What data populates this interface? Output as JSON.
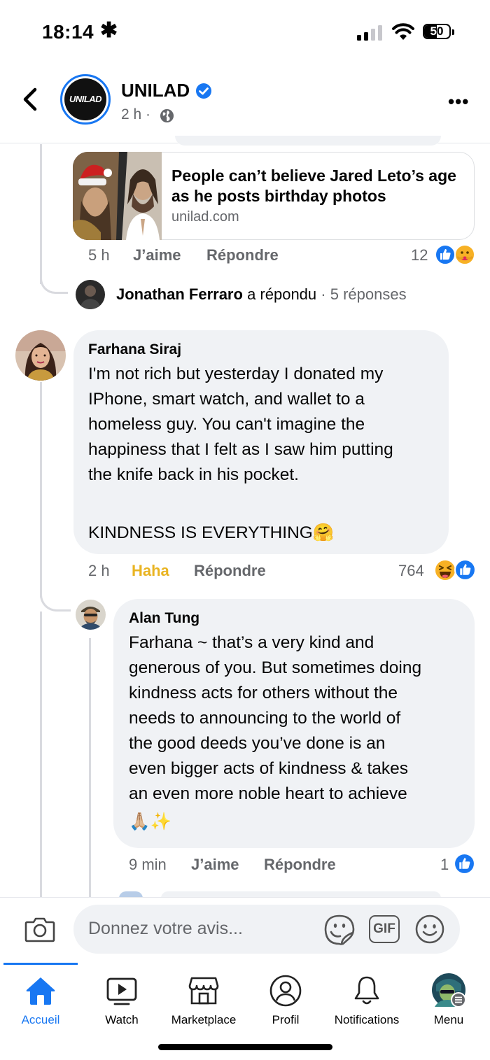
{
  "status_bar": {
    "time": "18:14",
    "dnd_symbol": "✱",
    "battery": "50",
    "battery_level": 0.5
  },
  "header": {
    "page_name": "UNILAD",
    "logo_text": "UNILAD",
    "post_time": "2 h ·"
  },
  "link_preview": {
    "title": "People can’t believe Jared Leto’s age as he posts birthday photos",
    "domain": "unilad.com"
  },
  "previous_comment_meta": {
    "time": "5 h",
    "like": "J’aime",
    "reply": "Répondre",
    "reaction_count": "12",
    "reactions": [
      "like-icon",
      "care-icon"
    ]
  },
  "reply_summary": {
    "name": "Jonathan Ferraro",
    "text": "a répondu",
    "count": "· 5 réponses"
  },
  "comments": [
    {
      "author": "Farhana Siraj",
      "lines": [
        "I'm not rich but yesterday I donated my",
        "IPhone, smart watch, and wallet to a",
        "homeless guy. You can't imagine the",
        "happiness that I felt as I saw him putting",
        "the knife back in his pocket.",
        "",
        "KINDNESS IS EVERYTHING🤗"
      ],
      "time": "2 h",
      "reaction_label": "Haha",
      "reply": "Répondre",
      "reaction_count": "764",
      "reactions": [
        "haha-icon",
        "like-icon"
      ]
    },
    {
      "author": "Alan Tung",
      "lines": [
        "Farhana ~ that’s a very kind and",
        "generous of you. But sometimes doing",
        "kindness acts for others without the",
        "needs to announcing to the world of",
        "the good deeds you’ve done is an",
        "even bigger acts of kindness & takes",
        "an even more noble heart to achieve",
        "🙏🏼✨"
      ],
      "time": "9 min",
      "like": "J’aime",
      "reply": "Répondre",
      "reaction_count": "1",
      "reactions": [
        "like-icon"
      ]
    }
  ],
  "composer": {
    "placeholder": "Donnez votre avis...",
    "gif_label": "GIF"
  },
  "tabs": [
    {
      "label": "Accueil",
      "icon": "home-icon",
      "active": true
    },
    {
      "label": "Watch",
      "icon": "watch-icon"
    },
    {
      "label": "Marketplace",
      "icon": "marketplace-icon"
    },
    {
      "label": "Profil",
      "icon": "profile-icon"
    },
    {
      "label": "Notifications",
      "icon": "bell-icon"
    },
    {
      "label": "Menu",
      "icon": "menu-avatar-icon"
    }
  ],
  "colors": {
    "accent": "#1877f2",
    "haha": "#e9b422",
    "bubble": "#f0f2f5",
    "secondary_text": "#65676b"
  }
}
